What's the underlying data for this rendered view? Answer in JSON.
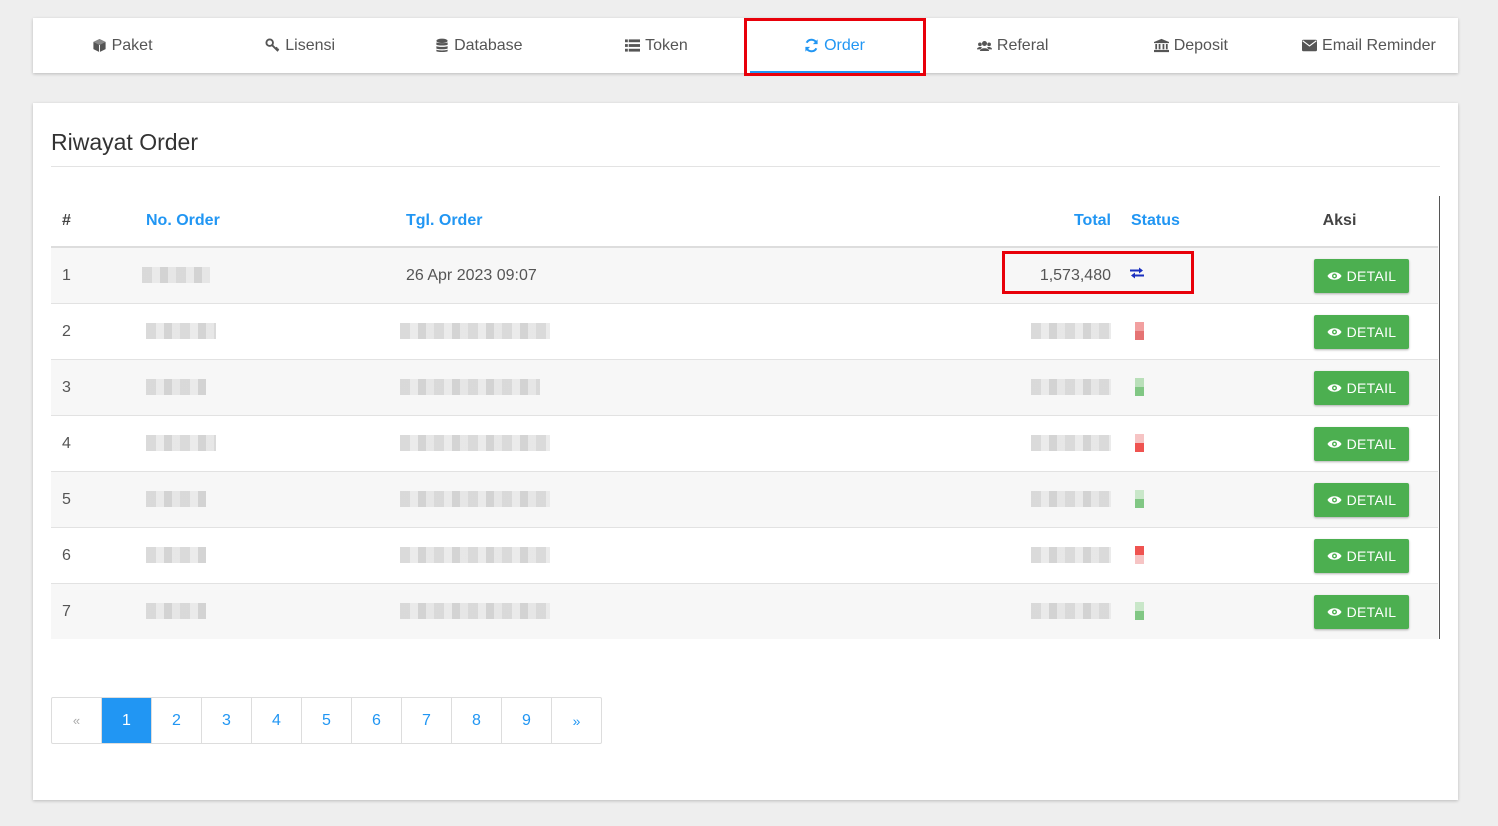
{
  "tabs": [
    {
      "label": "Paket",
      "icon": "cube-icon"
    },
    {
      "label": "Lisensi",
      "icon": "key-icon"
    },
    {
      "label": "Database",
      "icon": "database-icon"
    },
    {
      "label": "Token",
      "icon": "list-icon"
    },
    {
      "label": "Order",
      "icon": "refresh-icon",
      "active": true
    },
    {
      "label": "Referal",
      "icon": "users-icon"
    },
    {
      "label": "Deposit",
      "icon": "bank-icon"
    },
    {
      "label": "Email Reminder",
      "icon": "envelope-icon"
    }
  ],
  "panel": {
    "title": "Riwayat Order",
    "columns": {
      "num": "#",
      "order_no": "No. Order",
      "order_date": "Tgl. Order",
      "total": "Total",
      "status": "Status",
      "action": "Aksi"
    },
    "rows": [
      {
        "num": "1",
        "order_no": "",
        "order_date": "26 Apr 2023 09:07",
        "total": "1,573,480",
        "status_icon": "exchange-icon",
        "detail": "DETAIL"
      },
      {
        "num": "2",
        "detail": "DETAIL",
        "status_color": "#e57373"
      },
      {
        "num": "3",
        "detail": "DETAIL",
        "status_color": "#81c784"
      },
      {
        "num": "4",
        "detail": "DETAIL",
        "status_color": "#ef5350"
      },
      {
        "num": "5",
        "detail": "DETAIL",
        "status_color": "#81c784"
      },
      {
        "num": "6",
        "detail": "DETAIL",
        "status_color": "#ef5350"
      },
      {
        "num": "7",
        "detail": "DETAIL",
        "status_color": "#81c784"
      }
    ]
  },
  "pagination": {
    "prev": "«",
    "pages": [
      "1",
      "2",
      "3",
      "4",
      "5",
      "6",
      "7",
      "8",
      "9"
    ],
    "next": "»",
    "current": "1"
  },
  "colors": {
    "accent": "#2196f3",
    "success": "#4caf50",
    "highlight": "#e8000a"
  }
}
